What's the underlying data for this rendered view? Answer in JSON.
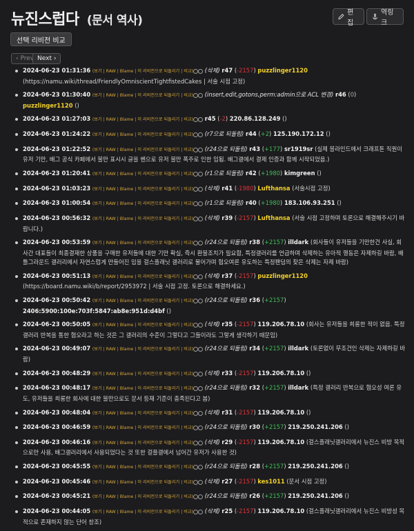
{
  "page": {
    "title": "뉴진스럽다",
    "subtitle": "(문서 역사)",
    "edit_label": "편집",
    "backlink_label": "역링크",
    "compare_label": "선택 리비전 비교",
    "prev_label": "‹ Prev",
    "next_label": "Next ›"
  },
  "tools": [
    "보기",
    "RAW",
    "Blame",
    "이 리비전으로 되돌리기",
    "비교"
  ],
  "history": [
    {
      "date": "2024-06-23 01:31:36",
      "summary": "(삭제)",
      "rev": "r47",
      "delta": "-2157",
      "user": "puzzlinger1120",
      "user_type": "link",
      "message": "https://namu.wiki/thread/FriendlyOmniscientTightfistedCakes | 서술 시점 고정"
    },
    {
      "date": "2024-06-23 01:30:40",
      "summary": "(insert,edit,gotons,perm:admin으로 ACL 변경)",
      "rev": "r46",
      "delta": "0",
      "user": "puzzlinger1120",
      "user_type": "link",
      "message": ""
    },
    {
      "date": "2024-06-23 01:27:03",
      "summary": "",
      "rev": "r45",
      "delta": "-2",
      "user": "220.86.128.249",
      "user_type": "ip",
      "message": ""
    },
    {
      "date": "2024-06-23 01:24:22",
      "summary": "(r7으로 되돌림)",
      "rev": "r44",
      "delta": "+2",
      "user": "125.190.172.12",
      "user_type": "ip",
      "message": ""
    },
    {
      "date": "2024-06-23 01:22:52",
      "summary": "(r24으로 되돌림)",
      "rev": "r43",
      "delta": "+177",
      "user": "sr1919sr",
      "user_type": "ip",
      "message": "실제 블라인드에서 크래프톤 직원이 유저 기만, 배그 공식 카페에서 불만 표시시 글을 벤으로 유저 불만 폭주로 인한 임됨. 배그갤에서 결제 인증과 함께 시작되었음."
    },
    {
      "date": "2024-06-23 01:20:41",
      "summary": "(r1으로 되돌림)",
      "rev": "r42",
      "delta": "+1980",
      "user": "kimgreen",
      "user_type": "ip",
      "message": ""
    },
    {
      "date": "2024-06-23 01:03:23",
      "summary": "(삭제)",
      "rev": "r41",
      "delta": "-1980",
      "user": "Lufthansa",
      "user_type": "link",
      "message": "서술시점 고정"
    },
    {
      "date": "2024-06-23 01:00:54",
      "summary": "(r1으로 되돌림)",
      "rev": "r40",
      "delta": "+1980",
      "user": "183.106.93.251",
      "user_type": "ip",
      "message": ""
    },
    {
      "date": "2024-06-23 00:56:32",
      "summary": "(삭제)",
      "rev": "r39",
      "delta": "-2157",
      "user": "Lufthansa",
      "user_type": "link",
      "message": "서술 시점 고정하며 토론으로 해결해주시기 바랍니다."
    },
    {
      "date": "2024-06-23 00:53:59",
      "summary": "(r24으로 되돌림)",
      "rev": "r38",
      "delta": "+2157",
      "user": "illdark",
      "user_type": "ip",
      "message": "회사들이 유저들을 기만한건 사실, 회사간 대표들이 최종결재한 상품을 구매한 유저들에 대한 기만 확실, 즉시 환불조치가 필요함, 특정갤러리를 언급하며 삭제하는 유아적 행동은 자제하길 바람, 배틀그라운드 갤러리에서 자연스럽게 만들어진 밈을 걸스플래닛 갤러리로 물어가며 험오여론 유도하는 특정팬덤의 찾은 삭제는 자제 바람"
    },
    {
      "date": "2024-06-23 00:51:13",
      "summary": "(삭제)",
      "rev": "r37",
      "delta": "-2157",
      "user": "puzzlinger1120",
      "user_type": "link",
      "message": "https://board.namu.wiki/b/report/2953972 | 서술 시점 고정. 토론으로 해결하세요."
    },
    {
      "date": "2024-06-23 00:50:42",
      "summary": "(r24으로 되돌림)",
      "rev": "r36",
      "delta": "+2157",
      "user": "2406:5900:100e:703f:5847:ab8e:951d:d4bf",
      "user_type": "ip",
      "message": ""
    },
    {
      "date": "2024-06-23 00:50:05",
      "summary": "(삭제)",
      "rev": "r35",
      "delta": "-2157",
      "user": "119.206.78.10",
      "user_type": "ip",
      "message": "회사는 유저들을 희롱한 적이 없음. 특정 갤러리 반복을 통한 혐오라고 하는 것은 그 갤러리의 수준이 그렇다고 그들이라도 그렇게 생각하기 때문임"
    },
    {
      "date": "2024-06-23 00:49:07",
      "summary": "(r24으로 되돌림)",
      "rev": "r34",
      "delta": "+2157",
      "user": "illdark",
      "user_type": "ip",
      "message": "토론없이 무조건인 삭제는 자제하길 바람"
    },
    {
      "date": "2024-06-23 00:48:29",
      "summary": "(삭제)",
      "rev": "r33",
      "delta": "-2157",
      "user": "119.206.78.10",
      "user_type": "ip",
      "message": ""
    },
    {
      "date": "2024-06-23 00:48:17",
      "summary": "(r24으로 되돌림)",
      "rev": "r32",
      "delta": "+2157",
      "user": "illdark",
      "user_type": "ip",
      "message": "특정 갤러리 반복으로 혐오성 여론 유도, 유저들을 희롱한 회사에 대한 불만으로도 문서 등재 기준이 충족된다고 봄"
    },
    {
      "date": "2024-06-23 00:48:04",
      "summary": "(삭제)",
      "rev": "r31",
      "delta": "-2157",
      "user": "119.206.78.10",
      "user_type": "ip",
      "message": ""
    },
    {
      "date": "2024-06-23 00:46:59",
      "summary": "(r24으로 되돌림)",
      "rev": "r30",
      "delta": "+2157",
      "user": "219.250.241.206",
      "user_type": "ip",
      "message": ""
    },
    {
      "date": "2024-06-23 00:46:16",
      "summary": "(삭제)",
      "rev": "r29",
      "delta": "-2157",
      "user": "119.206.78.10",
      "user_type": "ip",
      "message": "걸스플래닛갤러리에서 뉴진스 비방 목적으로만 사용, 배그갤러리에서 사용되었다는 것 또한 걸플갤에서 넘어간 유저가 사용한 것"
    },
    {
      "date": "2024-06-23 00:45:55",
      "summary": "(r24으로 되돌림)",
      "rev": "r28",
      "delta": "+2157",
      "user": "219.250.241.206",
      "user_type": "ip",
      "message": ""
    },
    {
      "date": "2024-06-23 00:45:46",
      "summary": "(삭제)",
      "rev": "r27",
      "delta": "-2157",
      "user": "kes1011",
      "user_type": "link",
      "message": "문서 시점 고정"
    },
    {
      "date": "2024-06-23 00:45:21",
      "summary": "(r24으로 되돌림)",
      "rev": "r26",
      "delta": "+2157",
      "user": "219.250.241.206",
      "user_type": "ip",
      "message": ""
    },
    {
      "date": "2024-06-23 00:44:05",
      "summary": "(삭제)",
      "rev": "r25",
      "delta": "-2157",
      "user": "119.206.78.10",
      "user_type": "ip",
      "message": "걸스플래닛갤러리에서 뉴진스 비방성 목적으로 존재하지 않는 단어 창조"
    }
  ]
}
